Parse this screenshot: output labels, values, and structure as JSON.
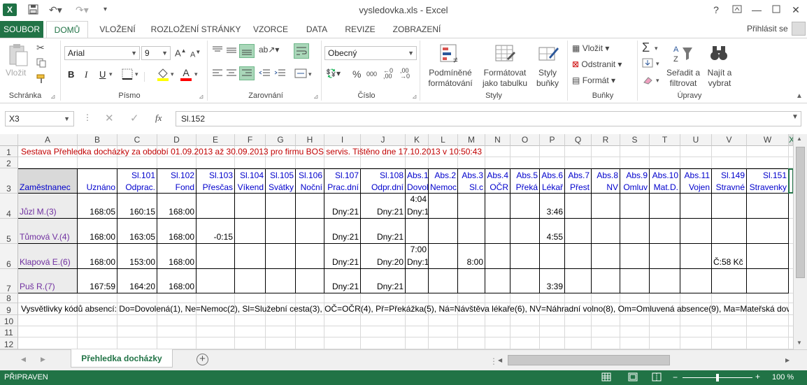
{
  "window": {
    "title": "vysledovka.xls - Excel",
    "help": "?",
    "minimize": "—",
    "close": "✕"
  },
  "ribbon_tabs": [
    "SOUBOR",
    "DOMŮ",
    "VLOŽENÍ",
    "ROZLOŽENÍ STRÁNKY",
    "VZORCE",
    "DATA",
    "REVIZE",
    "ZOBRAZENÍ"
  ],
  "signin": "Přihlásit se",
  "ribbon": {
    "clipboard": {
      "paste": "Vložit",
      "label": "Schránka"
    },
    "font": {
      "name": "Arial",
      "size": "9",
      "bold": "B",
      "italic": "I",
      "underline": "U",
      "label": "Písmo"
    },
    "alignment": {
      "label": "Zarovnání"
    },
    "number": {
      "format": "Obecný",
      "percent": "%",
      "thousands": "000",
      "label": "Číslo"
    },
    "styles": {
      "conditional_1": "Podmíněné",
      "conditional_2": "formátování",
      "table_1": "Formátovat",
      "table_2": "jako tabulku",
      "cellstyles_1": "Styly",
      "cellstyles_2": "buňky",
      "label": "Styly"
    },
    "cells": {
      "insert": "Vložit",
      "delete": "Odstranit",
      "format": "Formát",
      "label": "Buňky"
    },
    "editing": {
      "sort_1": "Seřadit a",
      "sort_2": "filtrovat",
      "find_1": "Najít a",
      "find_2": "vybrat",
      "label": "Úpravy"
    }
  },
  "formula_bar": {
    "name_box": "X3",
    "fx": "fx",
    "value": "Sl.152"
  },
  "columns": [
    "A",
    "B",
    "C",
    "D",
    "E",
    "F",
    "G",
    "H",
    "I",
    "J",
    "K",
    "L",
    "M",
    "N",
    "O",
    "P",
    "Q",
    "R",
    "S",
    "T",
    "U",
    "V",
    "W"
  ],
  "selected_column": "X",
  "rows": [
    "1",
    "2",
    "3",
    "4",
    "5",
    "6",
    "7",
    "8",
    "9",
    "10",
    "11",
    "12"
  ],
  "sheet": {
    "title_row": "Sestava Přehledka docházky za období 01.09.2013 až 30.09.2013 pro firmu BOS servis.  Tištěno dne 17.10.2013 v 10:50:43",
    "headers_top": [
      "",
      "",
      "Sl.101",
      "Sl.102",
      "Sl.103",
      "Sl.104",
      "Sl.105",
      "Sl.106",
      "Sl.107",
      "Sl.108",
      "Abs.1",
      "Abs.2",
      "Abs.3",
      "Abs.4",
      "Abs.5",
      "Abs.6",
      "Abs.7",
      "Abs.8",
      "Abs.9",
      "Abs.10",
      "Abs.11",
      "Sl.149",
      "Sl.151"
    ],
    "headers_bottom": [
      "Zaměstnanec",
      "Uznáno",
      "Odprac.",
      "Fond",
      "Přesčas",
      "Víkend",
      "Svátky",
      "Noční",
      "Prac.dní",
      "Odpr.dní",
      "Dovol",
      "Nemoc",
      "Sl.c",
      "OČR",
      "Překá",
      "Lékař",
      "Přest",
      "NV",
      "Omluv",
      "Mat.D.",
      "Vojen",
      "Stravné",
      "Stravenky"
    ],
    "employees": [
      {
        "name": "Jůzl M.(3)",
        "B": "168:05",
        "C": "160:15",
        "D": "168:00",
        "E": "",
        "I": "Dny:21",
        "J": "Dny:21",
        "K_top": "4:04",
        "K_bot": "Dny:1",
        "M": "",
        "P": "3:46",
        "V": ""
      },
      {
        "name": "Tůmová V.(4)",
        "B": "168:00",
        "C": "163:05",
        "D": "168:00",
        "E": "-0:15",
        "I": "Dny:21",
        "J": "Dny:21",
        "K_top": "",
        "K_bot": "",
        "M": "",
        "P": "4:55",
        "V": ""
      },
      {
        "name": "Klapová E.(6)",
        "B": "168:00",
        "C": "153:00",
        "D": "168:00",
        "E": "",
        "I": "Dny:21",
        "J": "Dny:20",
        "K_top": "7:00",
        "K_bot": "Dny:1",
        "M": "8:00",
        "P": "",
        "V": "Č:58 Kč"
      },
      {
        "name": "Puš R.(7)",
        "B": "167:59",
        "C": "164:20",
        "D": "168:00",
        "E": "",
        "I": "Dny:21",
        "J": "Dny:21",
        "K_top": "",
        "K_bot": "",
        "M": "",
        "P": "3:39",
        "V": ""
      }
    ],
    "legend_row": "Vysvětlivky kódů absencí: Do=Dovolená(1), Ne=Nemoc(2), Sl=Služební cesta(3), OČ=OČR(4), Př=Překážka(5), Ná=Návštěva lékaře(6), NV=Náhradní volno(8), Om=Omluvená absence(9), Ma=Mateřská dov"
  },
  "sheet_tab": "Přehledka docházky",
  "status": {
    "ready": "PŘIPRAVEN",
    "zoom": "100 %"
  },
  "colors": {
    "accent": "#217346",
    "title_red": "#c00000",
    "header_blue": "#0000cc",
    "name_purple": "#7030a0"
  }
}
